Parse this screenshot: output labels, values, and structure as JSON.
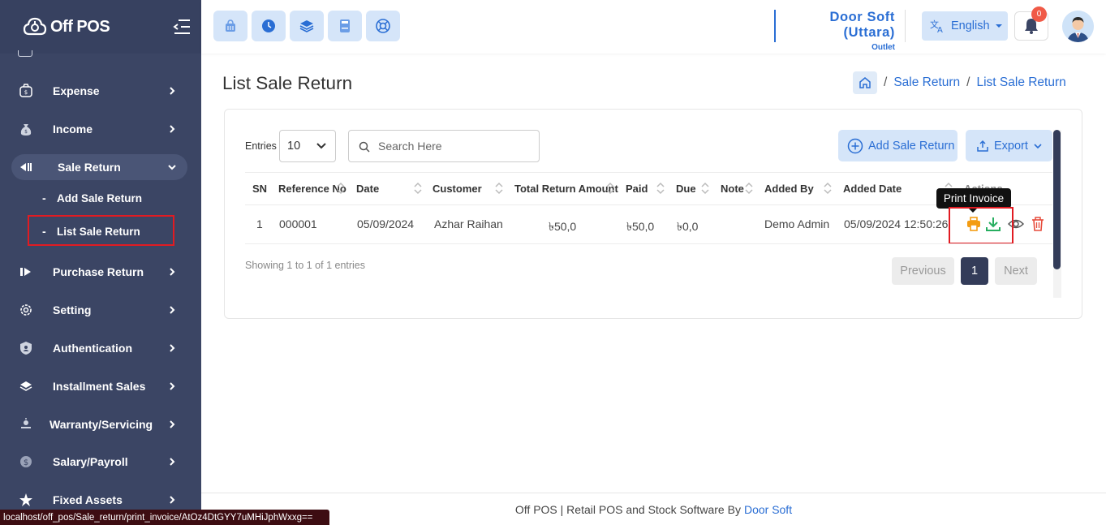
{
  "app": {
    "logo_text": "Off POS"
  },
  "sidebar": {
    "items": [
      {
        "label": "Expense"
      },
      {
        "label": "Income"
      },
      {
        "label": "Sale Return"
      },
      {
        "label": "Purchase Return"
      },
      {
        "label": "Setting"
      },
      {
        "label": "Authentication"
      },
      {
        "label": "Installment Sales"
      },
      {
        "label": "Warranty/Servicing"
      },
      {
        "label": "Salary/Payroll"
      },
      {
        "label": "Fixed Assets"
      }
    ],
    "sub_items": [
      {
        "label": "Add Sale Return"
      },
      {
        "label": "List Sale Return"
      }
    ]
  },
  "topbar": {
    "outlet_name": "Door Soft (Uttara)",
    "outlet_label": "Outlet",
    "language": "English",
    "notification_count": "0"
  },
  "page": {
    "title": "List Sale Return",
    "breadcrumb": [
      "Sale Return",
      "List Sale Return"
    ]
  },
  "table_controls": {
    "entries_label": "Entries",
    "entries_value": "10",
    "search_placeholder": "Search Here",
    "add_label": "Add Sale Return",
    "export_label": "Export"
  },
  "table": {
    "headers": [
      "SN",
      "Reference No",
      "Date",
      "Customer",
      "Total Return Amount",
      "Paid",
      "Due",
      "Note",
      "Added By",
      "Added Date",
      "Actions"
    ],
    "rows": [
      {
        "sn": "1",
        "ref": "000001",
        "date": "05/09/2024",
        "customer": "Azhar Raihan",
        "total": "৳50,0",
        "paid": "৳50,0",
        "due": "৳0,0",
        "note": "",
        "added_by": "Demo Admin",
        "added_date": "05/09/2024 12:50:26"
      }
    ],
    "tooltip": "Print Invoice"
  },
  "pagination": {
    "info": "Showing 1 to 1 of 1 entries",
    "previous": "Previous",
    "current": "1",
    "next": "Next"
  },
  "footer": {
    "text": "Off POS | Retail POS and Stock Software By",
    "link": "Door Soft"
  },
  "status_url": "localhost/off_pos/Sale_return/print_invoice/AtOz4DtGYY7uMHiJphWxxg==",
  "colors": {
    "sidebar": "#3b4564",
    "accent": "#2a6ed4",
    "danger": "#e11b22"
  }
}
